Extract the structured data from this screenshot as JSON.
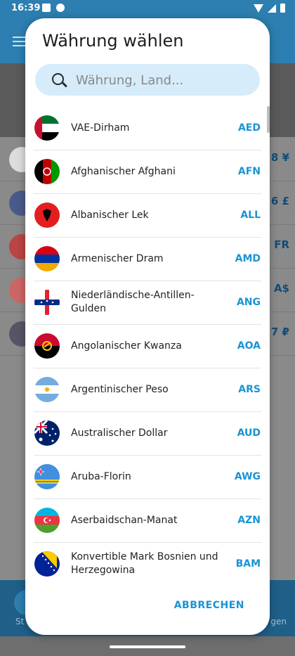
{
  "status_bar": {
    "time": "16:39"
  },
  "background": {
    "values": [
      "8 ¥",
      "6 £",
      "FR",
      "A$",
      "7 ₽"
    ],
    "bottom_left": "St",
    "bottom_right": "gen"
  },
  "dialog": {
    "title": "Währung wählen",
    "search_placeholder": "Währung, Land...",
    "cancel_label": "ABBRECHEN",
    "currencies": [
      {
        "name": "VAE-Dirham",
        "code": "AED",
        "flag": "uae-flag-icon"
      },
      {
        "name": "Afghanischer Afghani",
        "code": "AFN",
        "flag": "afghanistan-flag-icon"
      },
      {
        "name": "Albanischer Lek",
        "code": "ALL",
        "flag": "albania-flag-icon"
      },
      {
        "name": "Armenischer Dram",
        "code": "AMD",
        "flag": "armenia-flag-icon"
      },
      {
        "name": "Niederländische-Antillen-Gulden",
        "code": "ANG",
        "flag": "netherlands-antilles-flag-icon"
      },
      {
        "name": "Angolanischer Kwanza",
        "code": "AOA",
        "flag": "angola-flag-icon"
      },
      {
        "name": "Argentinischer Peso",
        "code": "ARS",
        "flag": "argentina-flag-icon"
      },
      {
        "name": "Australischer Dollar",
        "code": "AUD",
        "flag": "australia-flag-icon"
      },
      {
        "name": "Aruba-Florin",
        "code": "AWG",
        "flag": "aruba-flag-icon"
      },
      {
        "name": "Aserbaidschan-Manat",
        "code": "AZN",
        "flag": "azerbaijan-flag-icon"
      },
      {
        "name": "Konvertible Mark Bosnien und Herzegowina",
        "code": "BAM",
        "flag": "bosnia-flag-icon"
      }
    ]
  }
}
